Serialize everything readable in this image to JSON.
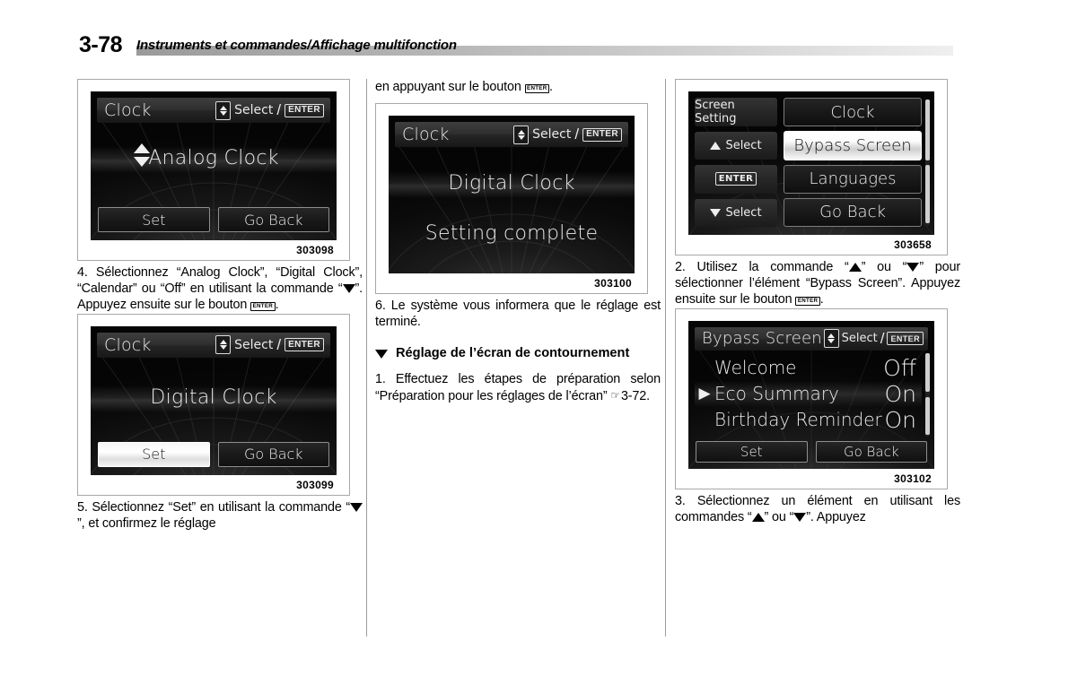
{
  "header": {
    "page_number": "3-78",
    "title": "Instruments et commandes/Affichage multifonction"
  },
  "columns": {
    "left": {
      "figure1": {
        "caption": "303098",
        "screen": {
          "title": "Clock",
          "select_label": "Select",
          "separator": "/",
          "enter_label": "ENTER",
          "center_text": "Analog Clock",
          "button_set": "Set",
          "button_go_back": "Go Back",
          "selected_button": ""
        }
      },
      "step4": "4. Sélectionnez “Analog Clock”, “Digital Clock”, “Calendar” ou “Off” en utilisant la commande “",
      "step4_b": "”. Appuyez ensuite sur le bouton ",
      "step4_c": ".",
      "figure2": {
        "caption": "303099",
        "screen": {
          "title": "Clock",
          "select_label": "Select",
          "separator": "/",
          "enter_label": "ENTER",
          "center_text": "Digital Clock",
          "button_set": "Set",
          "button_go_back": "Go Back",
          "selected_button": "Set"
        }
      },
      "step5": "5. Sélectionnez “Set” en utilisant la commande “",
      "step5_b": "”, et confirmez le réglage"
    },
    "middle": {
      "continued_text_a": "en appuyant sur le bouton ",
      "continued_text_b": ".",
      "figure3": {
        "caption": "303100",
        "screen": {
          "title": "Clock",
          "select_label": "Select",
          "separator": "/",
          "enter_label": "ENTER",
          "center_text": "Digital Clock",
          "status_text": "Setting complete"
        }
      },
      "step6": "6. Le système vous informera que le réglage est terminé.",
      "section_heading": "Réglage de l’écran de contournement",
      "step1_a": "1. Effectuez les étapes de préparation selon “Préparation pour les réglages de l’écran” ",
      "step1_ref": "3-72.",
      "hand_glyph": "☞"
    },
    "right": {
      "figure4": {
        "caption": "303658",
        "screen": {
          "side_label": "Screen Setting",
          "side_up": "Select",
          "side_enter": "ENTER",
          "side_down": "Select",
          "items": [
            {
              "label": "Clock",
              "selected": false
            },
            {
              "label": "Bypass Screen",
              "selected": true
            },
            {
              "label": "Languages",
              "selected": false
            },
            {
              "label": "Go Back",
              "selected": false
            }
          ]
        }
      },
      "step2_a": "2. Utilisez la commande “",
      "step2_b": "” ou “",
      "step2_c": "” pour sélectionner l’élément “Bypass Screen”. Appuyez ensuite sur le bouton ",
      "step2_d": ".",
      "figure5": {
        "caption": "303102",
        "screen": {
          "title": "Bypass Screen",
          "select_label": "Select",
          "separator": "/",
          "enter_label": "ENTER",
          "rows": [
            {
              "marker": "",
              "name": "Welcome",
              "value": "Off",
              "highlighted": false
            },
            {
              "marker": "▶",
              "name": "Eco Summary",
              "value": "On",
              "highlighted": true
            },
            {
              "marker": "",
              "name": "Birthday Reminder",
              "value": "On",
              "highlighted": false
            }
          ],
          "button_set": "Set",
          "button_go_back": "Go Back"
        }
      },
      "step3_a": "3. Sélectionnez un élément en utilisant les commandes “",
      "step3_b": "” ou “",
      "step3_c": "”. Appuyez"
    }
  }
}
